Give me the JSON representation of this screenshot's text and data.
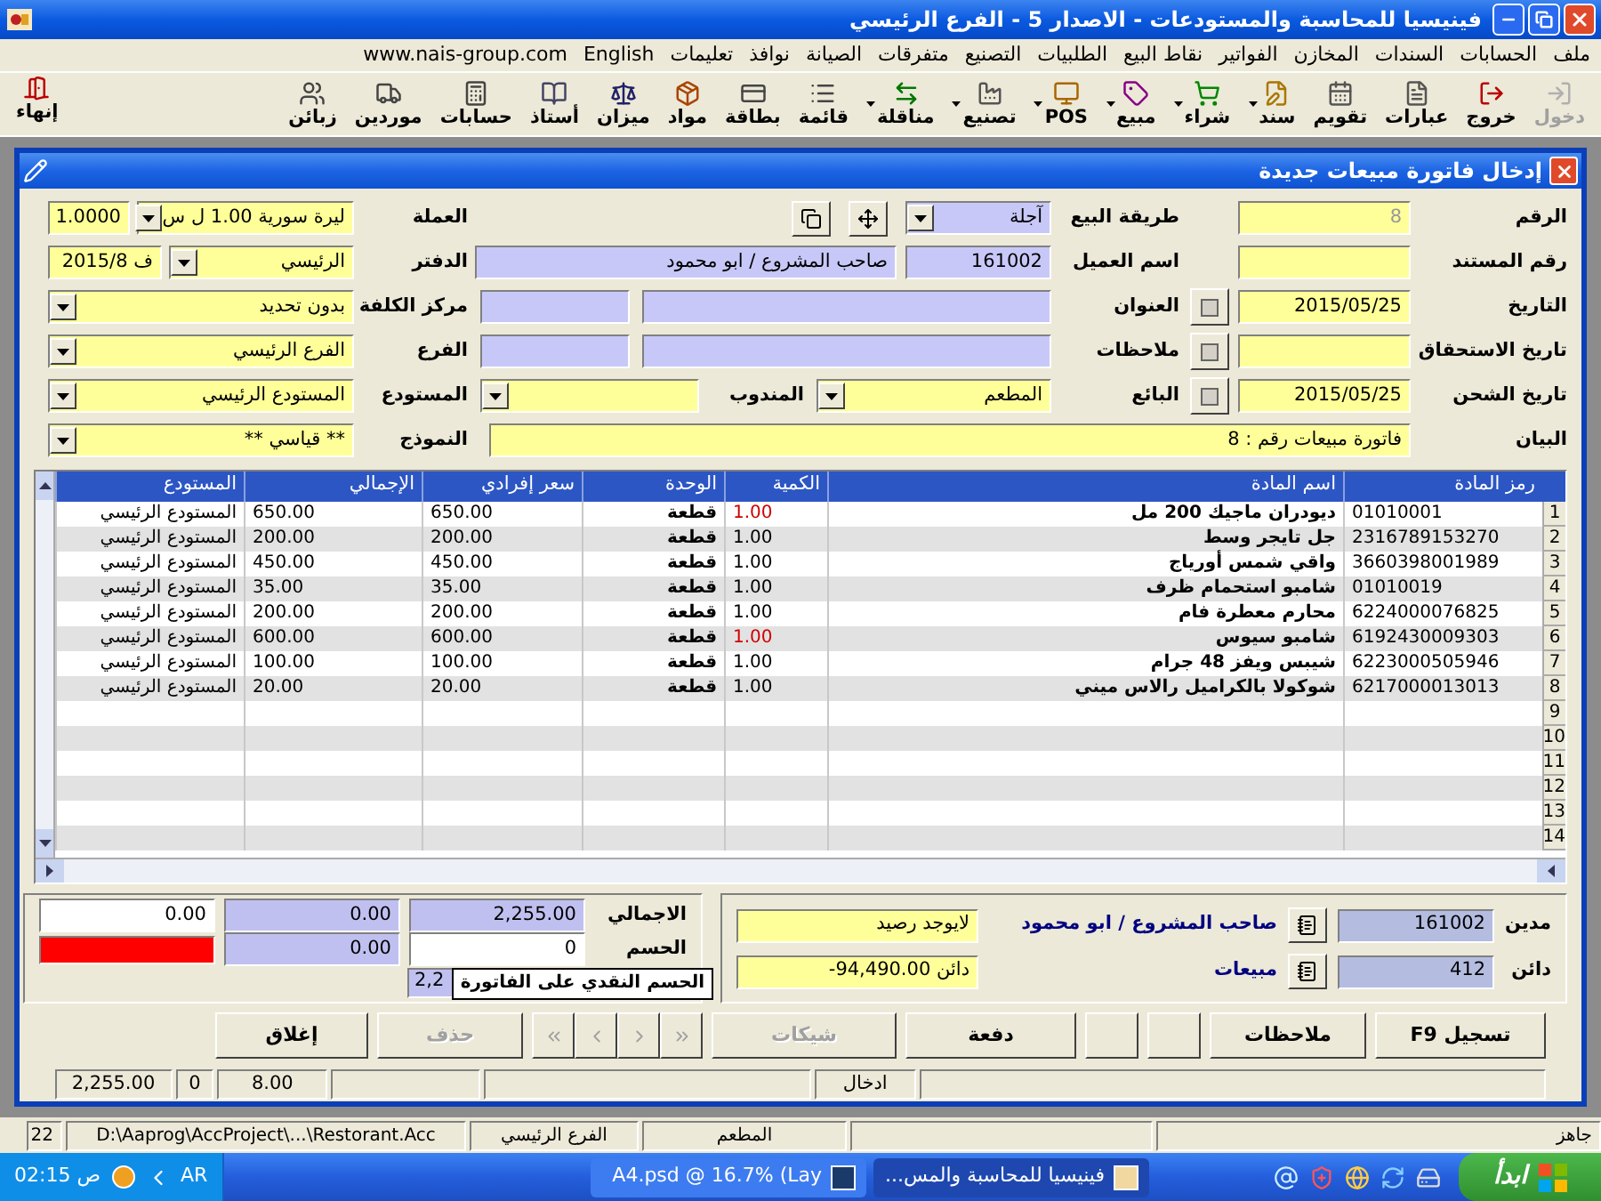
{
  "window": {
    "title": "فينيسيا للمحاسبة والمستودعات - الاصدار 5 - الفرع الرئيسي"
  },
  "menu": [
    "ملف",
    "الحسابات",
    "السندات",
    "المخازن",
    "الفواتير",
    "نقاط البيع",
    "الطلبيات",
    "التصنيع",
    "متفرقات",
    "الصيانة",
    "نوافذ",
    "تعليمات",
    "English",
    "www.nais-group.com"
  ],
  "toolbar": [
    {
      "label": "دخول",
      "disabled": true,
      "dropdown": false
    },
    {
      "label": "خروج",
      "disabled": false,
      "dropdown": false
    },
    {
      "label": "عبارات",
      "disabled": false,
      "dropdown": false
    },
    {
      "label": "تقويم",
      "disabled": false,
      "dropdown": false
    },
    {
      "label": "سند",
      "disabled": false,
      "dropdown": true
    },
    {
      "label": "شراء",
      "disabled": false,
      "dropdown": true
    },
    {
      "label": "مبيع",
      "disabled": false,
      "dropdown": true
    },
    {
      "label": "POS",
      "disabled": false,
      "dropdown": true
    },
    {
      "label": "تصنيع",
      "disabled": false,
      "dropdown": true
    },
    {
      "label": "مناقلة",
      "disabled": false,
      "dropdown": true
    },
    {
      "label": "قائمة",
      "disabled": false,
      "dropdown": false
    },
    {
      "label": "بطاقة",
      "disabled": false,
      "dropdown": false
    },
    {
      "label": "مواد",
      "disabled": false,
      "dropdown": false
    },
    {
      "label": "ميزان",
      "disabled": false,
      "dropdown": false
    },
    {
      "label": "أستاذ",
      "disabled": false,
      "dropdown": false
    },
    {
      "label": "حسابات",
      "disabled": false,
      "dropdown": false
    },
    {
      "label": "موردين",
      "disabled": false,
      "dropdown": false
    },
    {
      "label": "زبائن",
      "disabled": false,
      "dropdown": false
    }
  ],
  "exit_button": {
    "label": "إنهاء"
  },
  "invoice_window": {
    "title": "إدخال فاتورة مبيعات جديدة"
  },
  "form": {
    "number": {
      "label": "الرقم",
      "value": "8"
    },
    "document_number": {
      "label": "رقم المستند"
    },
    "date": {
      "label": "التاريخ",
      "value": "2015/05/25"
    },
    "due_date": {
      "label": "تاريخ الاستحقاق"
    },
    "shipping_date": {
      "label": "تاريخ الشحن",
      "value": "2015/05/25"
    },
    "sale_method": {
      "label": "طريقة البيع",
      "value": "آجلة"
    },
    "customer": {
      "label": "اسم العميل",
      "code": "161002",
      "name": "صاحب المشروع / ابو محمود"
    },
    "address": {
      "label": "العنوان"
    },
    "notes": {
      "label": "ملاحظات"
    },
    "seller": {
      "label": "البائع",
      "value": "المطعم"
    },
    "delegate": {
      "label": "المندوب"
    },
    "currency": {
      "label": "العملة",
      "value": "ليرة سورية 1.00 ل س",
      "rate": "1.0000"
    },
    "ledger": {
      "label": "الدفتر",
      "value": "الرئيسي",
      "period": "ف 2015/8"
    },
    "cost_center": {
      "label": "مركز الكلفة",
      "value": "بدون تحديد"
    },
    "branch": {
      "label": "الفرع",
      "value": "الفرع الرئيسي"
    },
    "warehouse": {
      "label": "المستودع",
      "value": "المستودع الرئيسي"
    },
    "description": {
      "label": "البيان",
      "value": "فاتورة مبيعات رقم : 8"
    },
    "template": {
      "label": "النموذج",
      "value": "** قياسي **"
    }
  },
  "items_table": {
    "columns": [
      "رمز المادة",
      "اسم المادة",
      "الكمية",
      "الوحدة",
      "سعر إفرادي",
      "الإجمالي",
      "المستودع"
    ],
    "rows": [
      {
        "number": "1",
        "cells": [
          "01010001",
          "ديودران ماجيك 200 مل",
          "1.00",
          "قطعة",
          "650.00",
          "650.00",
          "المستودع الرئيسي"
        ],
        "flagged": true
      },
      {
        "number": "2",
        "cells": [
          "2316789153270",
          "جل تايجر وسط",
          "1.00",
          "قطعة",
          "200.00",
          "200.00",
          "المستودع الرئيسي"
        ],
        "flagged": false
      },
      {
        "number": "3",
        "cells": [
          "3660398001989",
          "واقي شمس أورياج",
          "1.00",
          "قطعة",
          "450.00",
          "450.00",
          "المستودع الرئيسي"
        ],
        "flagged": false
      },
      {
        "number": "4",
        "cells": [
          "01010019",
          "شامبو استحمام ظرف",
          "1.00",
          "قطعة",
          "35.00",
          "35.00",
          "المستودع الرئيسي"
        ],
        "flagged": false
      },
      {
        "number": "5",
        "cells": [
          "6224000076825",
          "محارم معطرة فام",
          "1.00",
          "قطعة",
          "200.00",
          "200.00",
          "المستودع الرئيسي"
        ],
        "flagged": false
      },
      {
        "number": "6",
        "cells": [
          "6192430009303",
          "شامبو سيوس",
          "1.00",
          "قطعة",
          "600.00",
          "600.00",
          "المستودع الرئيسي"
        ],
        "flagged": true
      },
      {
        "number": "7",
        "cells": [
          "6223000505946",
          "شيبس ويفز 48 جرام",
          "1.00",
          "قطعة",
          "100.00",
          "100.00",
          "المستودع الرئيسي"
        ],
        "flagged": false
      },
      {
        "number": "8",
        "cells": [
          "6217000013013",
          "شوكولا بالكراميل رالاس ميني",
          "1.00",
          "قطعة",
          "20.00",
          "20.00",
          "المستودع الرئيسي"
        ],
        "flagged": false
      }
    ],
    "empty_rows": [
      "9",
      "10",
      "11",
      "12",
      "13",
      "14"
    ]
  },
  "accounts": {
    "debit": {
      "label": "مدين",
      "code": "161002",
      "name": "صاحب المشروع / ابو محمود",
      "balance": "لايوجد رصيد"
    },
    "credit": {
      "label": "دائن",
      "code": "412",
      "name": "مبيعات",
      "balance": "-94,490.00 دائن"
    }
  },
  "totals": {
    "total_label": "الاجمالي",
    "total": "2,255.00",
    "total_2": "0.00",
    "total_3": "0.00",
    "discount_label": "الحسم",
    "discount": "0",
    "discount_2": "0.00",
    "net": "2,2",
    "tooltip": "الحسم النقدي على الفاتورة"
  },
  "buttons": [
    {
      "kind": "text",
      "label": "تسجيل F9",
      "disabled": false
    },
    {
      "kind": "text",
      "label": "ملاحظات",
      "disabled": false
    },
    {
      "kind": "blank"
    },
    {
      "kind": "blank"
    },
    {
      "kind": "text",
      "label": "دفعة",
      "disabled": false
    },
    {
      "kind": "text",
      "label": "شيكات",
      "disabled": true
    },
    {
      "kind": "nav",
      "disabled": true
    },
    {
      "kind": "text",
      "label": "حذف",
      "disabled": true
    },
    {
      "kind": "text",
      "label": "إغلاق",
      "disabled": false
    }
  ],
  "window_status": [
    {
      "kind": "empty"
    },
    {
      "kind": "text",
      "text": "ادخال"
    },
    {
      "kind": "empty"
    },
    {
      "kind": "empty"
    },
    {
      "kind": "text",
      "text": "8.00"
    },
    {
      "kind": "text",
      "text": "0"
    },
    {
      "kind": "text",
      "text": "2,255.00"
    }
  ],
  "status_bar": [
    {
      "kind": "text",
      "text": "جاهز"
    },
    {
      "kind": "empty"
    },
    {
      "kind": "text",
      "text": "المطعم"
    },
    {
      "kind": "text",
      "text": "الفرع الرئيسي"
    },
    {
      "kind": "text",
      "text": "D:\\Aaprog\\AccProject\\...\\Restorant.Acc"
    },
    {
      "kind": "text",
      "text": "22"
    }
  ],
  "taskbar": {
    "start": "ابدأ",
    "tasks": [
      {
        "label": "فينيسيا للمحاسبة والمس...",
        "selected": true
      },
      {
        "label": "A4.psd @ 16.7% (Lay",
        "selected": false
      }
    ],
    "language": "AR",
    "clock": "02:15 ص"
  }
}
